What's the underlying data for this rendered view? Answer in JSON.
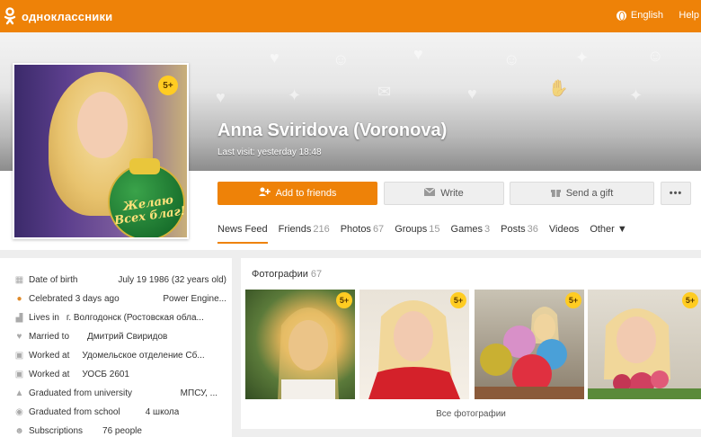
{
  "topbar": {
    "logo_text": "одноклассники",
    "language": "English",
    "help": "Help"
  },
  "profile": {
    "name": "Anna Sviridova (Voronova)",
    "last_visit": "Last visit: yesterday 18:48",
    "avatar_badge": "5+",
    "avatar_ball_text": "Желаю Всех благ!"
  },
  "actions": {
    "add": "Add to friends",
    "write": "Write",
    "gift": "Send a gift",
    "more": "•••"
  },
  "tabs": [
    {
      "label": "News Feed",
      "count": ""
    },
    {
      "label": "Friends",
      "count": "216"
    },
    {
      "label": "Photos",
      "count": "67"
    },
    {
      "label": "Groups",
      "count": "15"
    },
    {
      "label": "Games",
      "count": "3"
    },
    {
      "label": "Posts",
      "count": "36"
    },
    {
      "label": "Videos",
      "count": ""
    },
    {
      "label": "Other ▼",
      "count": ""
    }
  ],
  "info": [
    {
      "label": "Date of birth",
      "value": "July 19 1986 (32 years old)",
      "icon": "calendar-icon"
    },
    {
      "label": "Celebrated 3 days ago",
      "value": "Power Engine...",
      "icon": "balloons-icon"
    },
    {
      "label": "Lives in",
      "value": "г. Волгодонск (Ростовская обла...",
      "icon": "city-icon"
    },
    {
      "label": "Married to",
      "value": "Дмитрий Свиридов",
      "icon": "hearts-icon"
    },
    {
      "label": "Worked at",
      "value": "Удомельское отделение Сб...",
      "icon": "briefcase-icon"
    },
    {
      "label": "Worked at",
      "value": "УОСБ 2601",
      "icon": "briefcase-icon"
    },
    {
      "label": "Graduated from university",
      "value": "МПСУ, ...",
      "icon": "graduation-cap-icon"
    },
    {
      "label": "Graduated from school",
      "value": "4 школа",
      "icon": "school-icon"
    },
    {
      "label": "Subscriptions",
      "value": "76 people",
      "icon": "people-icon"
    }
  ],
  "photos": {
    "title": "Фотографии",
    "count": "67",
    "badge": "5+",
    "all_link": "Все фотографии"
  },
  "colors": {
    "brand": "#ee8208"
  }
}
